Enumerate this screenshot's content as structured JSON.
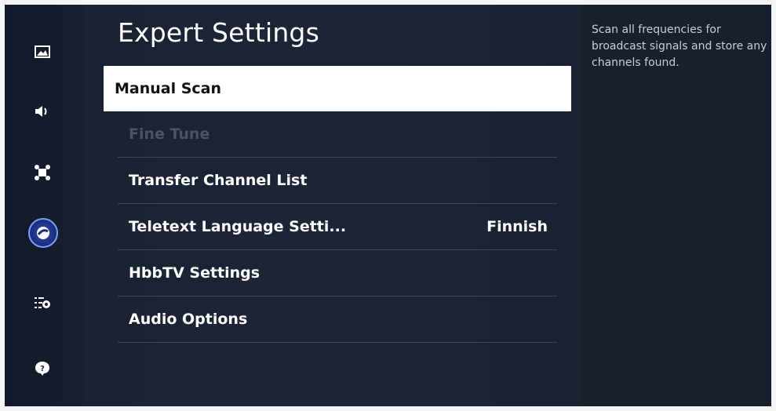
{
  "page": {
    "title": "Expert Settings"
  },
  "sidebar": {
    "items": [
      {
        "icon": "picture-icon"
      },
      {
        "icon": "sound-icon"
      },
      {
        "icon": "connection-icon"
      },
      {
        "icon": "broadcasting-icon",
        "active": true
      },
      {
        "icon": "general-icon"
      },
      {
        "icon": "support-icon"
      }
    ]
  },
  "menu": {
    "items": [
      {
        "label": "Manual Scan",
        "value": "",
        "state": "selected"
      },
      {
        "label": "Fine Tune",
        "value": "",
        "state": "disabled"
      },
      {
        "label": "Transfer Channel List",
        "value": "",
        "state": "normal"
      },
      {
        "label": "Teletext Language Setti...",
        "value": "Finnish",
        "state": "normal"
      },
      {
        "label": "HbbTV Settings",
        "value": "",
        "state": "normal"
      },
      {
        "label": "Audio Options",
        "value": "",
        "state": "normal"
      }
    ]
  },
  "description": {
    "text": "Scan all frequencies for broadcast signals and store any channels found."
  },
  "colors": {
    "background": "#1c2536",
    "selected_bg": "#ffffff",
    "active_icon_ring": "#7aa0ff",
    "disabled_text": "#4a5466"
  }
}
